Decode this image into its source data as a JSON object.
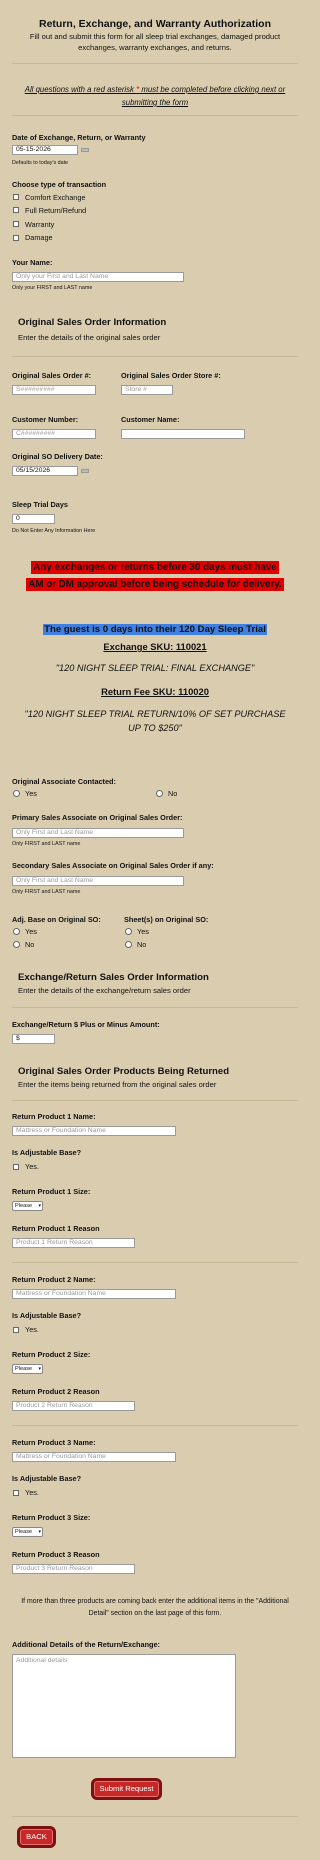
{
  "header": {
    "title": "Return, Exchange, and Warranty Authorization",
    "subtitle_line1": "Fill out and submit this form for all sleep trial exchanges, damaged product",
    "subtitle_line2": "exchanges, warranty exchanges, and returns.",
    "required_note_a": "All questions with a red asterisk ",
    "required_note_star": "*",
    "required_note_b": " must be completed before clicking next or",
    "required_note_line2": "submitting the form"
  },
  "date_exchange": {
    "label": "Date of Exchange, Return, or Warranty",
    "value": "05-15-2026",
    "note": "Defaults to today's date"
  },
  "transaction": {
    "label": "Choose type of transaction",
    "options": [
      "Comfort Exchange",
      "Full Return/Refund",
      "Warranty",
      "Damage"
    ]
  },
  "your_name": {
    "label": "Your Name:",
    "placeholder": "Only your First and Last Name",
    "note": "Only your FIRST and LAST name"
  },
  "orig_section": {
    "title": "Original Sales Order Information",
    "subtitle": "Enter the details of the original sales order"
  },
  "orig_fields": {
    "order_label": "Original Sales Order #:",
    "order_placeholder": "S#########",
    "store_label": "Original Sales Order Store #:",
    "store_placeholder": "Store #",
    "customer_no_label": "Customer Number:",
    "customer_no_placeholder": "C#########",
    "customer_name_label": "Customer Name:",
    "delivery_label": "Original SO Delivery Date:",
    "delivery_value": "05/15/2026",
    "sleep_label": "Sleep Trial Days",
    "sleep_value": "0",
    "sleep_note": "Do Not Enter Any Information Here"
  },
  "warnings": {
    "red_line1": "Any exchanges or returns before 30 days must have",
    "red_line2": "AM or DM approval before being schedule for delivery.",
    "blue": "The guest is 0 days into their 120 Day Sleep Trial",
    "exchange_sku": "Exchange SKU: 110021",
    "exchange_quote": "\"120 NIGHT SLEEP TRIAL: FINAL EXCHANGE\"",
    "return_sku": "Return Fee SKU: 110020",
    "return_quote_1": "\"120 NIGHT SLEEP TRIAL RETURN/10% OF SET PURCHASE",
    "return_quote_2": "UP TO $250\""
  },
  "associate": {
    "contacted_label": "Original Associate Contacted:",
    "yes": "Yes",
    "no": "No",
    "primary_label": "Primary Sales Associate on Original Sales Order:",
    "primary_placeholder": "Only First and Last Name",
    "primary_note": "Only FIRST and LAST name",
    "secondary_label": "Secondary Sales Associate on Original Sales Order if any:",
    "secondary_placeholder": "Only First and Last Name",
    "secondary_note": "Only FIRST and LAST name",
    "adj_label": "Adj. Base on Original SO:",
    "sheets_label": "Sheet(s) on Original SO:"
  },
  "exchange_section": {
    "title": "Exchange/Return Sales Order Information",
    "subtitle": "Enter the details of the exchange/return sales order",
    "amount_label": "Exchange/Return $ Plus or Minus Amount:",
    "amount_value": "$"
  },
  "products_section": {
    "title": "Original Sales Order Products Being Returned",
    "subtitle": "Enter the items being returned from the original sales order"
  },
  "products": [
    {
      "name_label": "Return Product 1 Name:",
      "name_placeholder": "Mattress or Foundation Name",
      "adj_label": "Is Adjustable Base?",
      "adj_yes": "Yes.",
      "size_label": "Return Product 1 Size:",
      "size_value": "Please",
      "reason_label": "Return Product 1 Reason",
      "reason_placeholder": "Product 1 Return Reason"
    },
    {
      "name_label": "Return Product 2 Name:",
      "name_placeholder": "Mattress or Foundation Name",
      "adj_label": "Is Adjustable Base?",
      "adj_yes": "Yes.",
      "size_label": "Return Product 2 Size:",
      "size_value": "Please",
      "reason_label": "Return Product 2 Reason",
      "reason_placeholder": "Product 2 Return Reason"
    },
    {
      "name_label": "Return Product 3 Name:",
      "name_placeholder": "Mattress or Foundation Name",
      "adj_label": "Is Adjustable Base?",
      "adj_yes": "Yes.",
      "size_label": "Return Product 3 Size:",
      "size_value": "Please",
      "reason_label": "Return Product 3 Reason",
      "reason_placeholder": "Product 3 Return Reason"
    }
  ],
  "additional": {
    "note_line1": "If more than three products are coming back enter the additional items in the \"Additional",
    "note_line2": "Detail\" section on the last page of this form.",
    "label": "Additional Details of the Return/Exchange:",
    "placeholder": "Additional details"
  },
  "buttons": {
    "submit": "Submit Request",
    "back": "BACK"
  },
  "colors": {
    "background": "#dacdaf",
    "warning_red": "#e00000",
    "highlight_blue": "#3f7fe0",
    "button_red": "#c62828"
  }
}
